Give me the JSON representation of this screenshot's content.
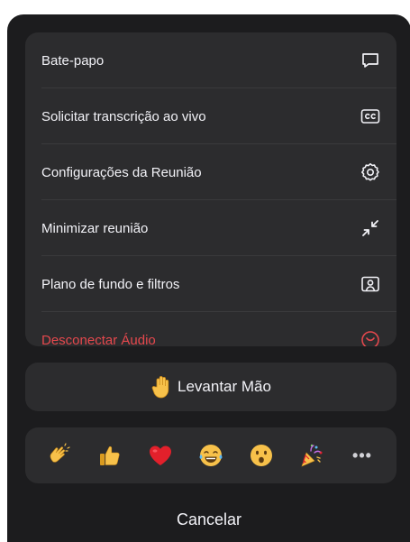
{
  "menu": {
    "items": [
      {
        "label": "Bate-papo",
        "icon": "chat-bubble-icon"
      },
      {
        "label": "Solicitar transcrição ao vivo",
        "icon": "closed-caption-icon"
      },
      {
        "label": "Configurações da Reunião",
        "icon": "gear-icon"
      },
      {
        "label": "Minimizar reunião",
        "icon": "minimize-arrows-icon"
      },
      {
        "label": "Plano de fundo e filtros",
        "icon": "background-filter-icon"
      },
      {
        "label": "Desconectar Áudio",
        "icon": "disconnect-audio-icon"
      }
    ]
  },
  "raise_hand": {
    "label": "Levantar Mão",
    "icon": "raised-hand-icon"
  },
  "reactions": {
    "items": [
      "clapping-hands",
      "thumbs-up",
      "red-heart",
      "tears-of-joy",
      "surprised-face",
      "party-popper"
    ],
    "more_label": "•••"
  },
  "cancel": {
    "label": "Cancelar"
  },
  "colors": {
    "sheet": "#1c1c1e",
    "card": "#2c2c2e",
    "text": "#f2f2f7",
    "danger": "#e5484d"
  }
}
